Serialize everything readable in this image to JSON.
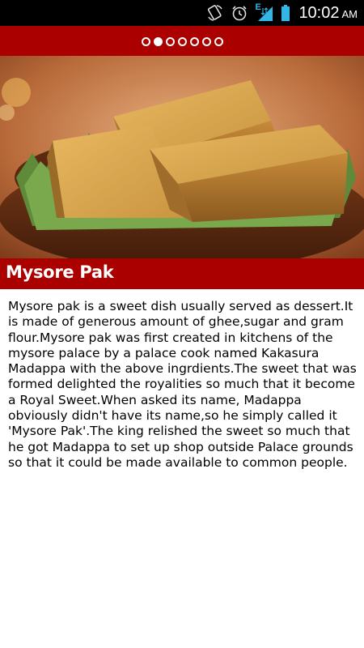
{
  "status_bar": {
    "time": "10:02",
    "ampm": "AM",
    "network_label": "E"
  },
  "pager": {
    "dot_count": 7,
    "active_index": 1
  },
  "hero": {
    "alt": "Mysore Pak pieces on leaves in a wooden bowl"
  },
  "dish": {
    "title": "Mysore Pak",
    "description": "Mysore pak is a sweet dish usually served as dessert.It is made of generous amount of ghee,sugar and gram flour.Mysore pak was first created in kitchens of the mysore palace by a palace cook named Kakasura Madappa with the above ingrdients.The sweet that was formed delighted the royalities so much that it become a Royal Sweet.When asked its name, Madappa obviously didn't have its name,so he simply called it 'Mysore Pak'.The king relished the sweet so much that he got Madappa to set up shop outside Palace grounds so that it could be made available to common people."
  },
  "colors": {
    "accent": "#aa0000",
    "status_bar": "#000000",
    "background": "#ffffff",
    "text": "#000000"
  },
  "icons": [
    "screen-rotate-icon",
    "alarm-clock-icon",
    "signal-strength-icon",
    "battery-icon"
  ]
}
